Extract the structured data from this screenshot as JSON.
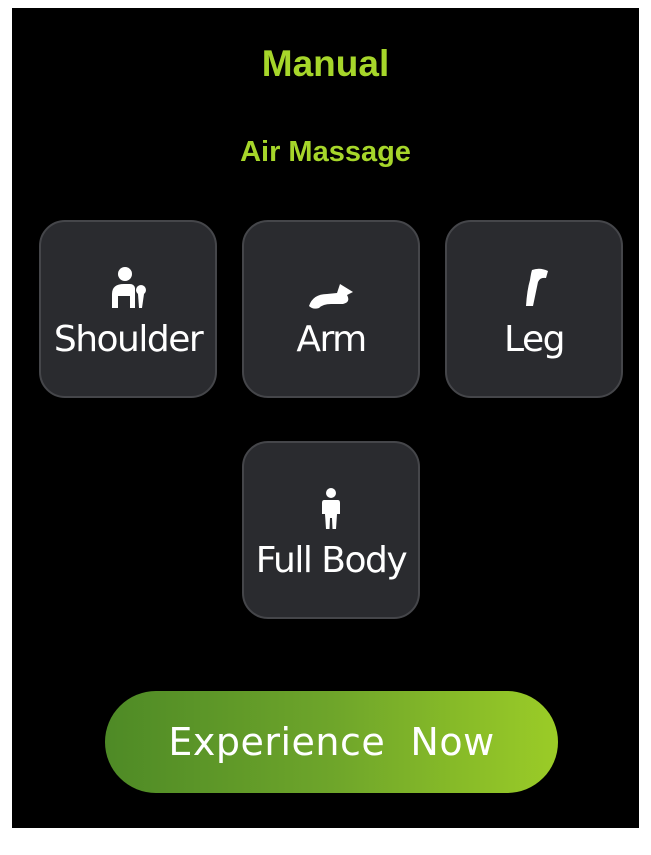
{
  "header": {
    "title": "Manual",
    "subtitle": "Air Massage"
  },
  "tiles": [
    {
      "label": "Shoulder",
      "icon": "shoulder-icon"
    },
    {
      "label": "Arm",
      "icon": "arm-icon"
    },
    {
      "label": "Leg",
      "icon": "leg-icon"
    },
    {
      "label": "Full Body",
      "icon": "full-body-icon"
    }
  ],
  "action": {
    "label": "Experience  Now"
  },
  "colors": {
    "accent": "#a6d62a",
    "tile_bg": "#2a2b2f",
    "tile_border": "#45464a",
    "screen_bg": "#000000",
    "button_gradient_start": "#4e8a26",
    "button_gradient_end": "#9bcc27"
  }
}
